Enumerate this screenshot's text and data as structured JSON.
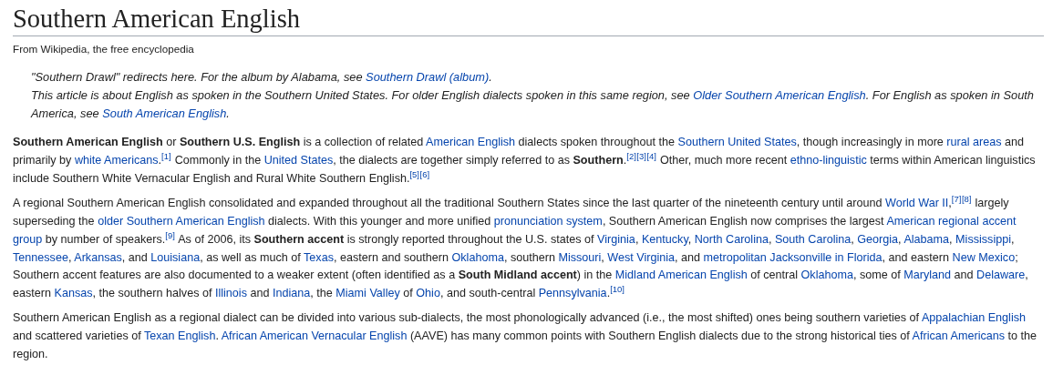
{
  "title": "Southern American English",
  "tagline": "From Wikipedia, the free encyclopedia",
  "hatnotes": [
    [
      {
        "kind": "text",
        "text": "\"Southern Drawl\" redirects here. For the album by Alabama, see "
      },
      {
        "kind": "link",
        "text": "Southern Drawl (album)"
      },
      {
        "kind": "text",
        "text": "."
      }
    ],
    [
      {
        "kind": "text",
        "text": "This article is about English as spoken in the Southern United States. For older English dialects spoken in this same region, see "
      },
      {
        "kind": "link",
        "text": "Older Southern American English"
      },
      {
        "kind": "text",
        "text": ". For English as spoken in South America, see "
      },
      {
        "kind": "link",
        "text": "South American English"
      },
      {
        "kind": "text",
        "text": "."
      }
    ]
  ],
  "paragraphs": [
    [
      {
        "kind": "bold",
        "text": "Southern American English"
      },
      {
        "kind": "text",
        "text": " or "
      },
      {
        "kind": "bold",
        "text": "Southern U.S. English"
      },
      {
        "kind": "text",
        "text": " is a collection of related "
      },
      {
        "kind": "link",
        "text": "American English"
      },
      {
        "kind": "text",
        "text": " dialects spoken throughout the "
      },
      {
        "kind": "link",
        "text": "Southern United States"
      },
      {
        "kind": "text",
        "text": ", though increasingly in more "
      },
      {
        "kind": "link",
        "text": "rural areas"
      },
      {
        "kind": "text",
        "text": " and primarily by "
      },
      {
        "kind": "link",
        "text": "white Americans"
      },
      {
        "kind": "text",
        "text": "."
      },
      {
        "kind": "ref",
        "text": "[1]"
      },
      {
        "kind": "text",
        "text": " Commonly in the "
      },
      {
        "kind": "link",
        "text": "United States"
      },
      {
        "kind": "text",
        "text": ", the dialects are together simply referred to as "
      },
      {
        "kind": "bold",
        "text": "Southern"
      },
      {
        "kind": "text",
        "text": "."
      },
      {
        "kind": "ref",
        "text": "[2]"
      },
      {
        "kind": "ref",
        "text": "[3]"
      },
      {
        "kind": "ref",
        "text": "[4]"
      },
      {
        "kind": "text",
        "text": " Other, much more recent "
      },
      {
        "kind": "link",
        "text": "ethno-linguistic"
      },
      {
        "kind": "text",
        "text": " terms within American linguistics include Southern White Vernacular English and Rural White Southern English."
      },
      {
        "kind": "ref",
        "text": "[5]"
      },
      {
        "kind": "ref",
        "text": "[6]"
      }
    ],
    [
      {
        "kind": "text",
        "text": "A regional Southern American English consolidated and expanded throughout all the traditional Southern States since the last quarter of the nineteenth century until around "
      },
      {
        "kind": "link",
        "text": "World War II"
      },
      {
        "kind": "text",
        "text": ","
      },
      {
        "kind": "ref",
        "text": "[7]"
      },
      {
        "kind": "ref",
        "text": "[8]"
      },
      {
        "kind": "text",
        "text": " largely superseding the "
      },
      {
        "kind": "link",
        "text": "older Southern American English"
      },
      {
        "kind": "text",
        "text": " dialects. With this younger and more unified "
      },
      {
        "kind": "link",
        "text": "pronunciation system"
      },
      {
        "kind": "text",
        "text": ", Southern American English now comprises the largest "
      },
      {
        "kind": "link",
        "text": "American regional accent",
        "space_after": true
      },
      {
        "kind": "link",
        "text": "group"
      },
      {
        "kind": "text",
        "text": " by number of speakers."
      },
      {
        "kind": "ref",
        "text": "[9]"
      },
      {
        "kind": "text",
        "text": " As of 2006, its "
      },
      {
        "kind": "bold",
        "text": "Southern accent"
      },
      {
        "kind": "text",
        "text": " is strongly reported throughout the U.S. states of "
      },
      {
        "kind": "link",
        "text": "Virginia"
      },
      {
        "kind": "text",
        "text": ", "
      },
      {
        "kind": "link",
        "text": "Kentucky"
      },
      {
        "kind": "text",
        "text": ", "
      },
      {
        "kind": "link",
        "text": "North Carolina"
      },
      {
        "kind": "text",
        "text": ", "
      },
      {
        "kind": "link",
        "text": "South Carolina"
      },
      {
        "kind": "text",
        "text": ", "
      },
      {
        "kind": "link",
        "text": "Georgia"
      },
      {
        "kind": "text",
        "text": ", "
      },
      {
        "kind": "link",
        "text": "Alabama"
      },
      {
        "kind": "text",
        "text": ", "
      },
      {
        "kind": "link",
        "text": "Mississippi"
      },
      {
        "kind": "text",
        "text": ", "
      },
      {
        "kind": "link",
        "text": "Tennessee"
      },
      {
        "kind": "text",
        "text": ", "
      },
      {
        "kind": "link",
        "text": "Arkansas"
      },
      {
        "kind": "text",
        "text": ", and "
      },
      {
        "kind": "link",
        "text": "Louisiana"
      },
      {
        "kind": "text",
        "text": ", as well as much of "
      },
      {
        "kind": "link",
        "text": "Texas"
      },
      {
        "kind": "text",
        "text": ", eastern and southern "
      },
      {
        "kind": "link",
        "text": "Oklahoma"
      },
      {
        "kind": "text",
        "text": ", southern "
      },
      {
        "kind": "link",
        "text": "Missouri"
      },
      {
        "kind": "text",
        "text": ", "
      },
      {
        "kind": "link",
        "text": "West Virginia"
      },
      {
        "kind": "text",
        "text": ", and "
      },
      {
        "kind": "link",
        "text": "metropolitan Jacksonville in Florida"
      },
      {
        "kind": "text",
        "text": ", and eastern "
      },
      {
        "kind": "link",
        "text": "New Mexico"
      },
      {
        "kind": "text",
        "text": "; Southern accent features are also documented to a weaker extent (often identified as a "
      },
      {
        "kind": "bold",
        "text": "South Midland accent"
      },
      {
        "kind": "text",
        "text": ") in the "
      },
      {
        "kind": "link",
        "text": "Midland American English"
      },
      {
        "kind": "text",
        "text": " of central "
      },
      {
        "kind": "link",
        "text": "Oklahoma"
      },
      {
        "kind": "text",
        "text": ", some of "
      },
      {
        "kind": "link",
        "text": "Maryland"
      },
      {
        "kind": "text",
        "text": " and "
      },
      {
        "kind": "link",
        "text": "Delaware"
      },
      {
        "kind": "text",
        "text": ", eastern "
      },
      {
        "kind": "link",
        "text": "Kansas"
      },
      {
        "kind": "text",
        "text": ", the southern halves of "
      },
      {
        "kind": "link",
        "text": "Illinois"
      },
      {
        "kind": "text",
        "text": " and "
      },
      {
        "kind": "link",
        "text": "Indiana"
      },
      {
        "kind": "text",
        "text": ", the "
      },
      {
        "kind": "link",
        "text": "Miami Valley"
      },
      {
        "kind": "text",
        "text": " of "
      },
      {
        "kind": "link",
        "text": "Ohio"
      },
      {
        "kind": "text",
        "text": ", and south-central "
      },
      {
        "kind": "link",
        "text": "Pennsylvania"
      },
      {
        "kind": "text",
        "text": "."
      },
      {
        "kind": "ref",
        "text": "[10]"
      }
    ],
    [
      {
        "kind": "text",
        "text": "Southern American English as a regional dialect can be divided into various sub-dialects, the most phonologically advanced (i.e., the most shifted) ones being southern varieties of "
      },
      {
        "kind": "link",
        "text": "Appalachian English"
      },
      {
        "kind": "text",
        "text": " and scattered varieties of "
      },
      {
        "kind": "link",
        "text": "Texan English"
      },
      {
        "kind": "text",
        "text": ". "
      },
      {
        "kind": "link",
        "text": "African American Vernacular English"
      },
      {
        "kind": "text",
        "text": " (AAVE) has many common points with Southern English dialects due to the strong historical ties of "
      },
      {
        "kind": "link",
        "text": "African Americans"
      },
      {
        "kind": "text",
        "text": " to the region."
      }
    ]
  ]
}
